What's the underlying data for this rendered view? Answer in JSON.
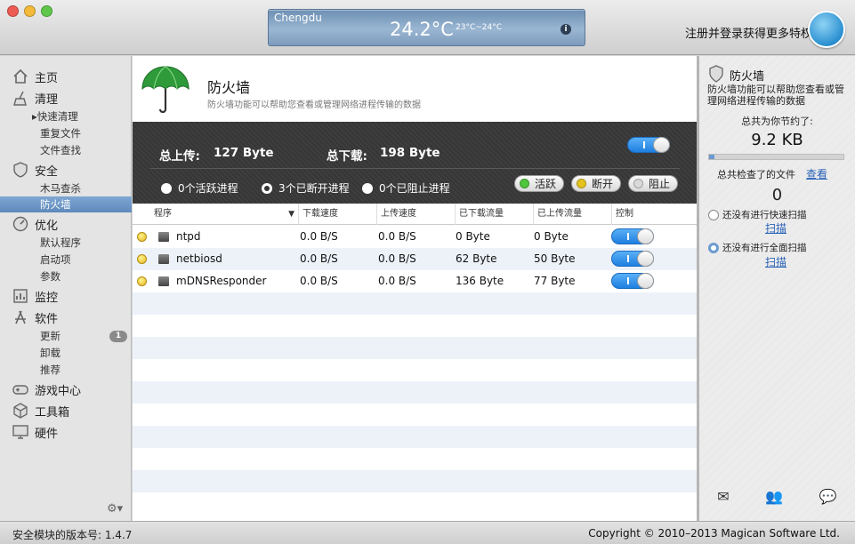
{
  "titlebar": {
    "weather": {
      "city": "Chengdu",
      "temp": "24.2°C",
      "range": "23°C~24°C",
      "info": "i"
    },
    "login": "注册并登录获得更多特权"
  },
  "sidebar": {
    "home": "主页",
    "clean": "清理",
    "clean_items": [
      "▸快速清理",
      "重复文件",
      "文件查找"
    ],
    "security": "安全",
    "security_items": [
      "木马查杀",
      "防火墙"
    ],
    "optimize": "优化",
    "optimize_items": [
      "默认程序",
      "启动项",
      "参数"
    ],
    "monitor": "监控",
    "software": "软件",
    "software_items": [
      "更新",
      "卸载",
      "推荐"
    ],
    "software_update_badge": "1",
    "game": "游戏中心",
    "toolbox": "工具箱",
    "hardware": "硬件",
    "gear": "⚙▾"
  },
  "main": {
    "title": "防火墙",
    "desc": "防火墙功能可以帮助您查看或管理网络进程传输的数据",
    "upload_label": "总上传:",
    "upload_value": "127 Byte",
    "download_label": "总下载:",
    "download_value": "198 Byte",
    "filters": [
      "0个活跃进程",
      "3个已断开进程",
      "0个已阻止进程"
    ],
    "selected_filter": "3个已断开进程",
    "legend": [
      {
        "label": "活跃",
        "color": "#4fc63b"
      },
      {
        "label": "断开",
        "color": "#e4c31e"
      },
      {
        "label": "阻止",
        "color": "#d9d9d9"
      }
    ],
    "columns": [
      "程序",
      "下载速度",
      "上传速度",
      "已下载流量",
      "已上传流量",
      "控制"
    ],
    "rows": [
      {
        "name": "ntpd",
        "down": "0.0 B/S",
        "up": "0.0 B/S",
        "downloaded": "0 Byte",
        "uploaded": "0 Byte"
      },
      {
        "name": "netbiosd",
        "down": "0.0 B/S",
        "up": "0.0 B/S",
        "downloaded": "62 Byte",
        "uploaded": "50 Byte"
      },
      {
        "name": "mDNSResponder",
        "down": "0.0 B/S",
        "up": "0.0 B/S",
        "downloaded": "136 Byte",
        "uploaded": "77 Byte"
      }
    ]
  },
  "right": {
    "title": "防火墙",
    "desc": "防火墙功能可以帮助您查看或管理网络进程传输的数据",
    "saved_label": "总共为你节约了:",
    "saved_value": "9.2 KB",
    "checked_label": "总共检查了的文件",
    "checked_link": "查看",
    "checked_value": "0",
    "quick_scan": "还没有进行快速扫描",
    "quick_scan_link": "扫描",
    "full_scan": "还没有进行全面扫描",
    "full_scan_link": "扫描"
  },
  "status": {
    "version": "安全模块的版本号: 1.4.7",
    "copyright": "Copyright © 2010–2013 Magican Software Ltd."
  }
}
